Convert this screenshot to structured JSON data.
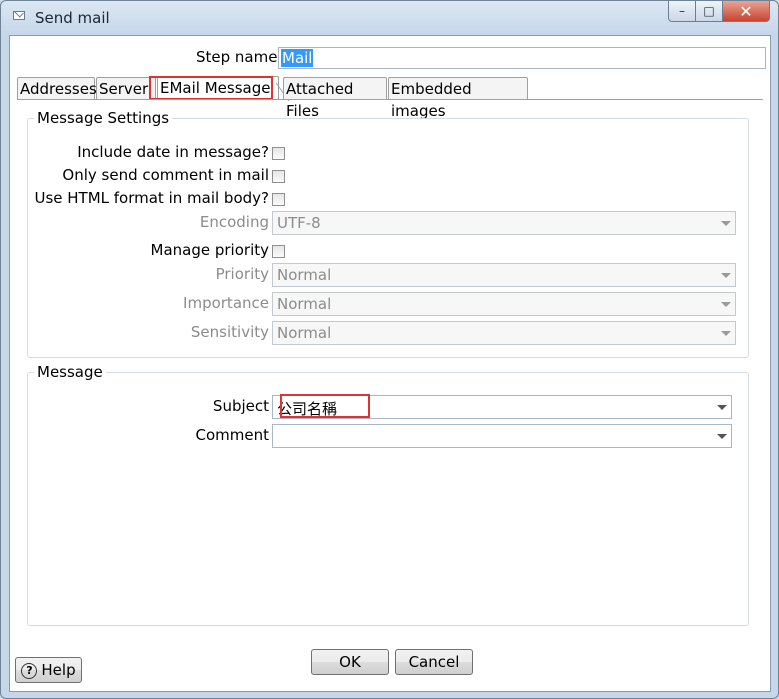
{
  "window": {
    "title": "Send mail",
    "controls": {
      "minimize": "–",
      "maximize": "□",
      "close": "✕"
    }
  },
  "step": {
    "label": "Step name",
    "value": "Mail"
  },
  "tabs": [
    {
      "label": "Addresses"
    },
    {
      "label": "Server"
    },
    {
      "label": "EMail Message",
      "active": true
    },
    {
      "label": "Attached Files"
    },
    {
      "label": "Embedded images"
    }
  ],
  "message_settings": {
    "title": "Message Settings",
    "include_date": "Include date in message?",
    "only_comment": "Only send comment in mail",
    "use_html": "Use HTML format in mail body?",
    "encoding_label": "Encoding",
    "encoding_value": "UTF-8",
    "manage_priority": "Manage priority",
    "priority_label": "Priority",
    "priority_value": "Normal",
    "importance_label": "Importance",
    "importance_value": "Normal",
    "sensitivity_label": "Sensitivity",
    "sensitivity_value": "Normal"
  },
  "message": {
    "title": "Message",
    "subject_label": "Subject",
    "subject_value": "公司名稱",
    "comment_label": "Comment",
    "comment_value": ""
  },
  "buttons": {
    "help": "Help",
    "help_icon": "?",
    "ok": "OK",
    "cancel": "Cancel"
  },
  "colors": {
    "highlight": "#dd3333",
    "selection": "#3399ff"
  }
}
